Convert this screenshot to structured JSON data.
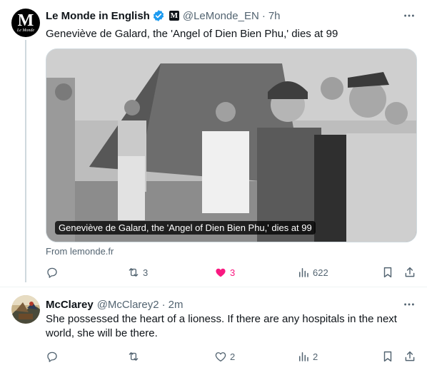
{
  "tweet1": {
    "author_name": "Le Monde in English",
    "avatar_letter": "M",
    "avatar_subtitle": "Le Monde",
    "badge_letter": "M",
    "handle": "@LeMonde_EN",
    "separator": "·",
    "time": "7h",
    "text": "Geneviève de Galard, the 'Angel of Dien Bien Phu,' dies at 99",
    "card_caption": "Geneviève de Galard, the 'Angel of Dien Bien Phu,' dies at 99",
    "card_source": "From lemonde.fr",
    "actions": {
      "reply_count": "",
      "retweet_count": "3",
      "like_count": "3",
      "views_count": "622"
    }
  },
  "tweet2": {
    "author_name": "McClarey",
    "handle": "@McClarey2",
    "separator": "·",
    "time": "2m",
    "text": "She possessed the heart of a lioness.  If there are any hospitals in the next world, she will be there.",
    "actions": {
      "reply_count": "",
      "retweet_count": "",
      "like_count": "2",
      "views_count": "2"
    }
  },
  "colors": {
    "verified_blue": "#1d9bf0",
    "like_pink": "#f91880",
    "secondary_text": "#536471",
    "divider": "#eff3f4"
  },
  "icons": {
    "reply": "reply-icon",
    "retweet": "retweet-icon",
    "like": "heart-icon",
    "views": "views-icon",
    "bookmark": "bookmark-icon",
    "share": "share-icon",
    "more": "more-icon",
    "verified": "verified-icon"
  }
}
